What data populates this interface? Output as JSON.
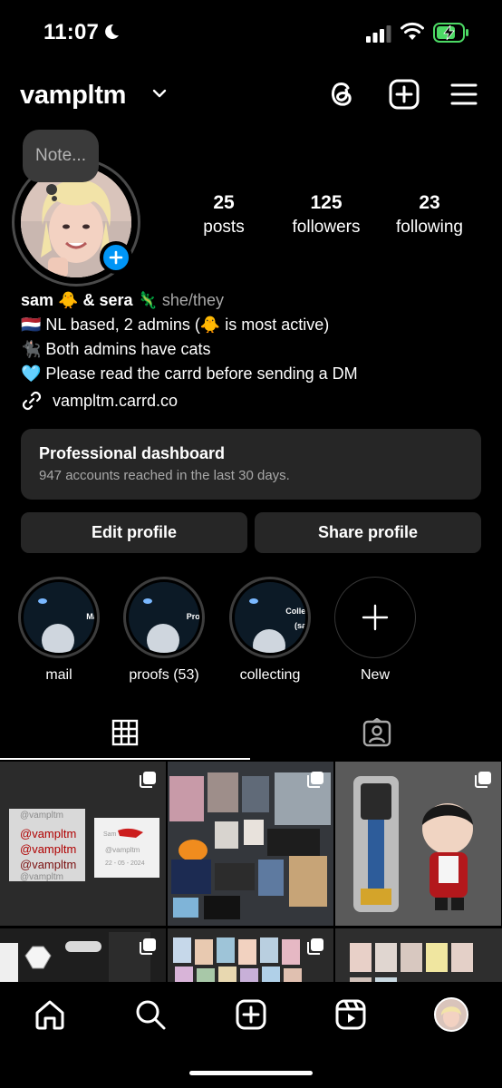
{
  "status_bar": {
    "time": "11:07"
  },
  "header": {
    "username": "vampltm"
  },
  "profile": {
    "note_placeholder": "Note...",
    "stats": [
      {
        "value": "25",
        "label": "posts"
      },
      {
        "value": "125",
        "label": "followers"
      },
      {
        "value": "23",
        "label": "following"
      }
    ],
    "bio": {
      "name": "sam 🐥 & sera 🦎",
      "pronouns": "she/they",
      "lines": [
        "🇳🇱 NL based, 2 admins (🐥 is most active)",
        "🐈‍⬛ Both admins have cats",
        "🩵 Please read the carrd before sending a DM"
      ],
      "link": "vampltm.carrd.co"
    }
  },
  "pro_dashboard": {
    "title": "Professional dashboard",
    "subtitle": "947 accounts reached in the last 30 days."
  },
  "buttons": {
    "edit": "Edit profile",
    "share": "Share profile"
  },
  "highlights": [
    {
      "cover_text": "Mail",
      "label": "mail"
    },
    {
      "cover_text": "Proofs",
      "label": "proofs (53)"
    },
    {
      "cover_text": "Collecting\n(sam)",
      "label": "collecting"
    },
    {
      "cover_text": "",
      "label": "New"
    }
  ],
  "photo_texts": {
    "tile1_stack": [
      "@vampltm",
      "@vampltm",
      "@vampltm",
      "@vampltm",
      "@vampltm"
    ],
    "tile1_card": [
      "Sam",
      "@vampltm",
      "22 - 05 - 2024"
    ]
  },
  "colors": {
    "accent": "#0095f6",
    "surface": "#262626",
    "background": "#000000"
  }
}
